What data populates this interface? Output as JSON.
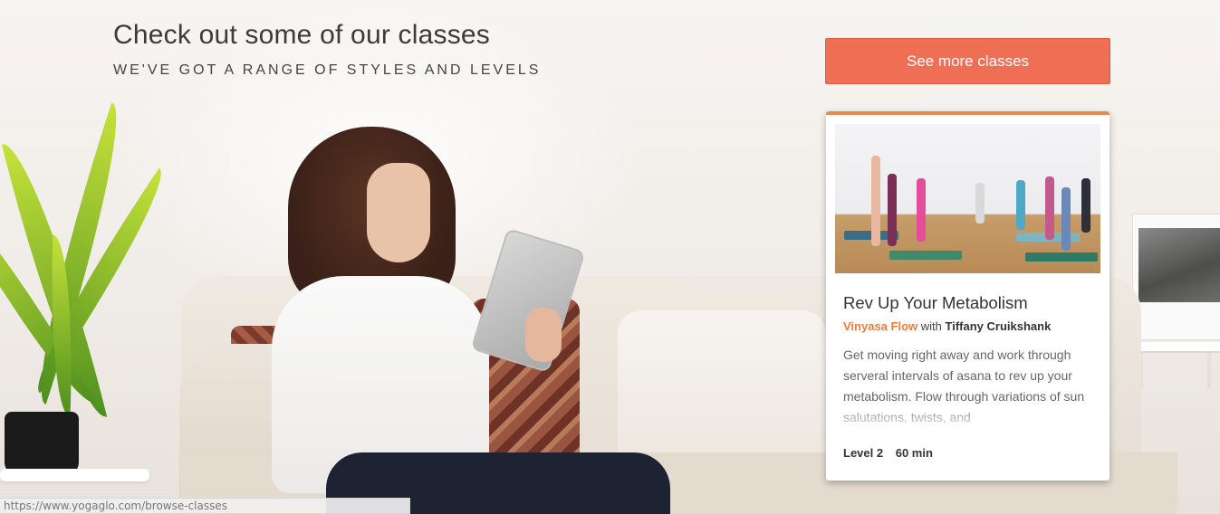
{
  "header": {
    "title": "Check out some of our classes",
    "subtitle": "WE'VE GOT A RANGE OF STYLES AND LEVELS"
  },
  "cta": {
    "label": "See more classes"
  },
  "class_card": {
    "accent_color": "#e58a52",
    "title": "Rev Up Your Metabolism",
    "style": "Vinyasa Flow",
    "with_word": "with",
    "teacher": "Tiffany Cruikshank",
    "description": "Get moving right away and work through serveral intervals of asana to rev up your metabolism. Flow through variations of sun salutations, twists, and",
    "level": "Level 2",
    "duration": "60 min"
  },
  "status_bar": {
    "url": "https://www.yogaglo.com/browse-classes"
  },
  "colors": {
    "cta_background": "#ef6f55",
    "style_link": "#ef7a3c"
  }
}
